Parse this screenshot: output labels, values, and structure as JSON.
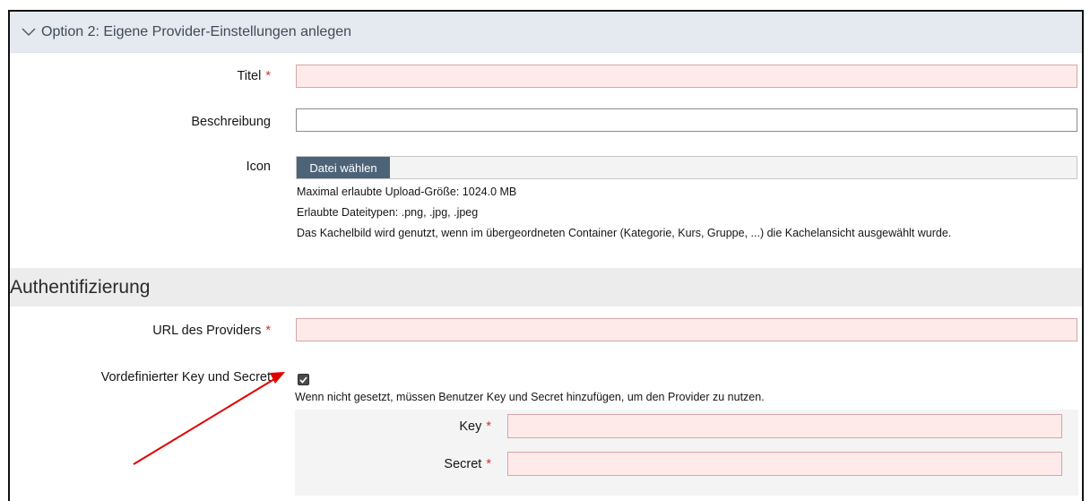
{
  "section": {
    "title": "Option 2: Eigene Provider-Einstellungen anlegen"
  },
  "required_mark": "*",
  "fields": {
    "titel": {
      "label": "Titel",
      "value": ""
    },
    "beschreibung": {
      "label": "Beschreibung",
      "value": ""
    },
    "icon": {
      "label": "Icon",
      "button_label": "Datei wählen",
      "help": [
        "Maximal erlaubte Upload-Größe: 1024.0 MB",
        "Erlaubte Dateitypen: .png, .jpg, .jpeg",
        "Das Kachelbild wird genutzt, wenn im übergeordneten Container (Kategorie, Kurs, Gruppe, ...) die Kachelansicht ausgewählt wurde."
      ]
    }
  },
  "auth": {
    "title": "Authentifizierung",
    "url": {
      "label": "URL des Providers",
      "value": ""
    },
    "predefined": {
      "label": "Vordefinierter Key und Secret",
      "checked": true,
      "help": "Wenn nicht gesetzt, müssen Benutzer Key und Secret hinzufügen, um den Provider zu nutzen."
    },
    "key": {
      "label": "Key",
      "value": ""
    },
    "secret": {
      "label": "Secret",
      "value": ""
    }
  },
  "colors": {
    "header_bg": "#e5eaf0",
    "required": "#d23232",
    "required_field_bg": "#ffeaea",
    "file_button": "#4d6478",
    "annotation_arrow": "#e00000"
  }
}
